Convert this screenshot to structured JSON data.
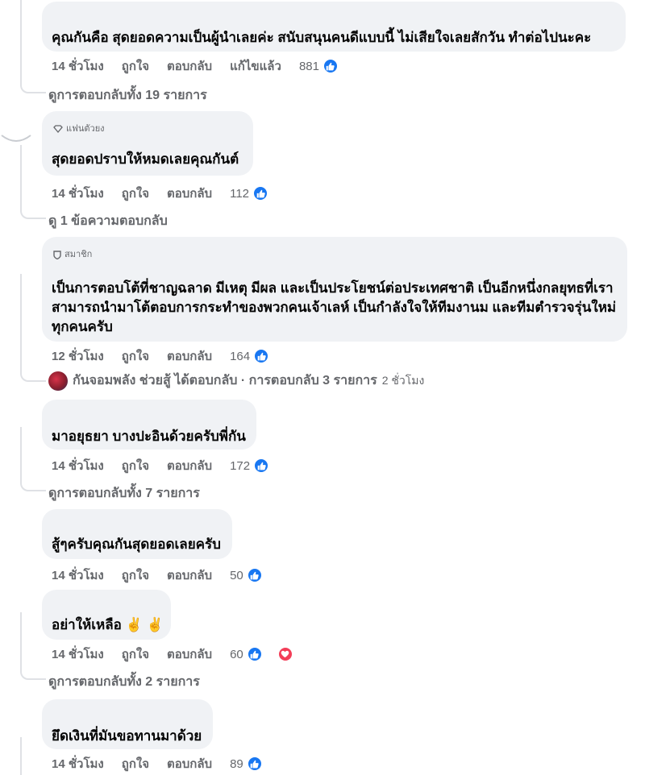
{
  "comments": [
    {
      "text": "คุณกันคือ สุดยอดความเป็นผู้นำเลยค่ะ สนับสนุนคนดีแบบนี้ ไม่เสียใจเลยสักวัน ทำต่อไปนะคะ",
      "time": "14 ชั่วโมง",
      "like": "ถูกใจ",
      "reply": "ตอบกลับ",
      "edited": "แก้ไขแล้ว",
      "count": "881",
      "replies_link": "ดูการตอบกลับทั้ง 19 รายการ"
    },
    {
      "badge": "แฟนตัวยง",
      "text": "สุดยอดปราบให้หมดเลยคุณกันต์",
      "time": "14 ชั่วโมง",
      "like": "ถูกใจ",
      "reply": "ตอบกลับ",
      "count": "112",
      "replies_link": "ดู 1 ข้อความตอบกลับ"
    },
    {
      "badge": "สมาชิก",
      "text_lines": [
        "เป็นการตอบโต้ที่ชาญฉลาด มีเหตุ มีผล และเป็นประโยชน์ต่อประเทศชาติ เป็นอีกหนึ่งกลยุทธที่เรา",
        "สามารถนำมาโต้ตอบการกระทำของพวกคนเจ้าเลห์ เป็นกำลังใจให้ทีมงานม และทีมตำรวจรุ่นใหม่",
        "ทุกคนครับ"
      ],
      "time": "12 ชั่วโมง",
      "like": "ถูกใจ",
      "reply": "ตอบกลับ",
      "count": "164",
      "reply_summary": "กันจอมพลัง ช่วยสู้ ได้ตอบกลับ · การตอบกลับ 3 รายการ",
      "reply_time": "2 ชั่วโมง"
    },
    {
      "text": "มาอยุธยา บางปะอินด้วยครับพี่กัน",
      "time": "14 ชั่วโมง",
      "like": "ถูกใจ",
      "reply": "ตอบกลับ",
      "count": "172",
      "replies_link": "ดูการตอบกลับทั้ง 7 รายการ"
    },
    {
      "text": "สู้ๆครับคุณกันสุดยอดเลยครับ",
      "time": "14 ชั่วโมง",
      "like": "ถูกใจ",
      "reply": "ตอบกลับ",
      "count": "50"
    },
    {
      "text": "อย่าให้เหลือ",
      "emoji": "✌️ ✌️",
      "time": "14 ชั่วโมง",
      "like": "ถูกใจ",
      "reply": "ตอบกลับ",
      "count": "60",
      "replies_link": "ดูการตอบกลับทั้ง 2 รายการ"
    },
    {
      "text": "ยึดเงินที่มันขอทานมาด้วย",
      "time": "14 ชั่วโมง",
      "like": "ถูกใจ",
      "reply": "ตอบกลับ",
      "count": "89"
    }
  ],
  "colors": {
    "bubble": "#f0f2f5",
    "secondary_text": "#65676b",
    "like_blue": "#1877f2",
    "love_red": "#f33e58",
    "thread_line": "#dfe1e5"
  },
  "icons": {
    "like": "thumbs-up-icon",
    "love": "heart-icon",
    "fan_badge": "diamond-icon",
    "member_badge": "shield-icon"
  }
}
